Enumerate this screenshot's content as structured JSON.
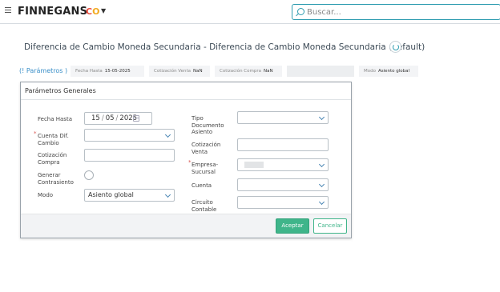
{
  "header": {
    "brand": "FINNEGANS",
    "brand_mark_c": "C",
    "brand_mark_o": "O",
    "search_placeholder": "Buscar..."
  },
  "page": {
    "title": "Diferencia de Cambio Moneda Secundaria - Diferencia de Cambio Moneda Secundaria (default)"
  },
  "params_bar": {
    "link_label": "Parámetros",
    "chips": [
      {
        "label": "Fecha Hasta",
        "value": "15-05-2025"
      },
      {
        "label": "Cotización Venta",
        "value": "NaN"
      },
      {
        "label": "Cotización Compra",
        "value": "NaN"
      },
      {
        "label": "Modo",
        "value": "Asiento global"
      }
    ]
  },
  "modal": {
    "title": "Parámetros Generales",
    "left_fields": {
      "fecha_hasta": {
        "label": "Fecha Hasta",
        "day": "15",
        "month": "05",
        "year": "2025"
      },
      "cuenta_dif_cambio": {
        "label_line1": "Cuenta Dif.",
        "label_line2": "Cambio",
        "required": true,
        "value": ""
      },
      "cotizacion_compra": {
        "label_line1": "Cotización",
        "label_line2": "Compra",
        "value": ""
      },
      "generar_contrasiento": {
        "label_line1": "Generar",
        "label_line2": "Contrasiento",
        "checked": false
      },
      "modo": {
        "label": "Modo",
        "value": "Asiento global"
      }
    },
    "right_fields": {
      "tipo_documento_asiento": {
        "label_line1": "Tipo",
        "label_line2": "Documento",
        "label_line3": "Asiento",
        "value": ""
      },
      "cotizacion_venta": {
        "label_line1": "Cotización",
        "label_line2": "Venta",
        "value": ""
      },
      "empresa_sucursal": {
        "label_line1": "Empresa-",
        "label_line2": "Sucursal",
        "required": true
      },
      "cuenta": {
        "label": "Cuenta",
        "value": ""
      },
      "circuito_contable": {
        "label_line1": "Circuito",
        "label_line2": "Contable",
        "value": ""
      }
    },
    "buttons": {
      "accept": "Aceptar",
      "cancel": "Cancelar"
    }
  },
  "colors": {
    "accent": "#2e9cb0",
    "accept_button": "#3fb58a",
    "required_mark": "#d9534f"
  }
}
